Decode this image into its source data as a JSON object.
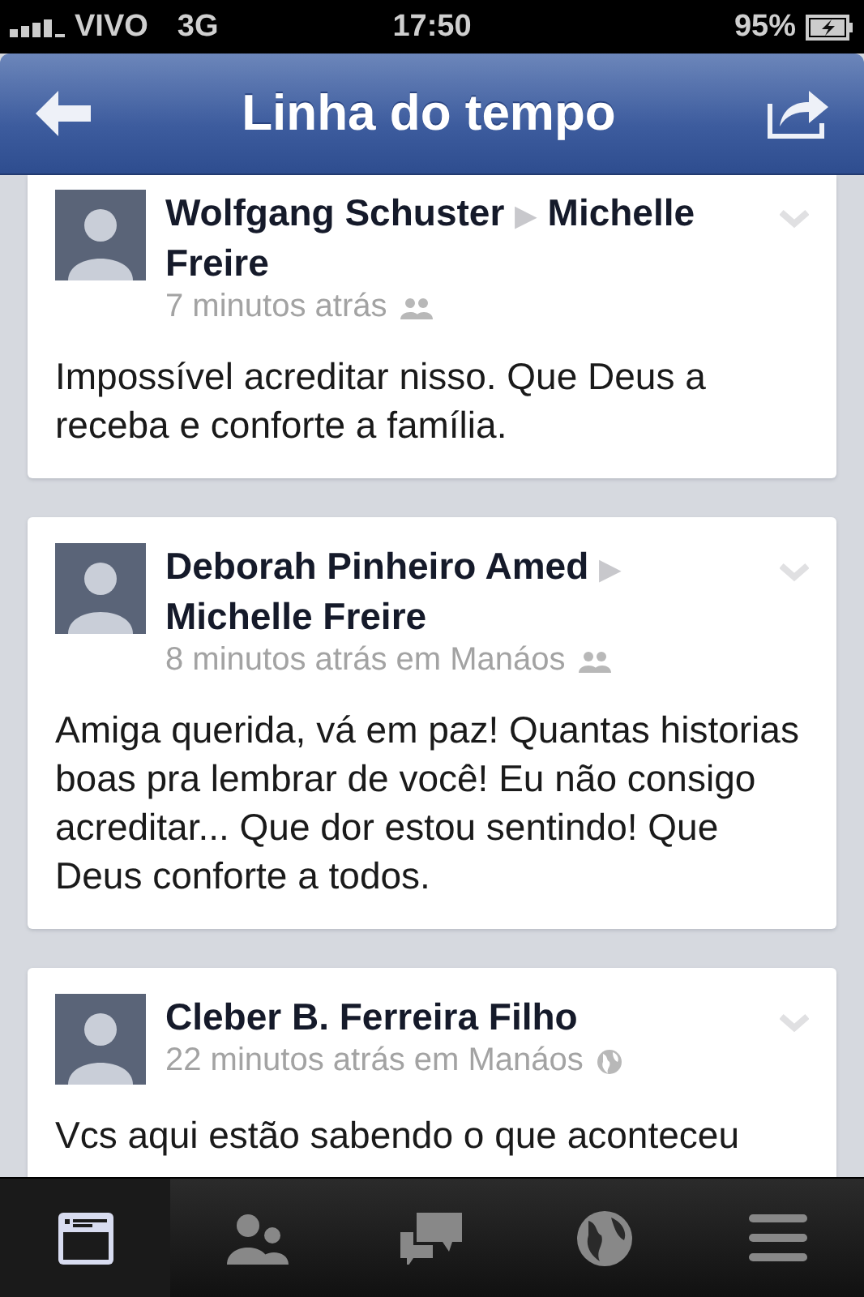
{
  "status_bar": {
    "carrier": "VIVO",
    "network": "3G",
    "time": "17:50",
    "battery": "95%"
  },
  "header": {
    "title": "Linha do tempo"
  },
  "posts": [
    {
      "author": "Wolfgang Schuster",
      "separator": "▶",
      "target": "Michelle Freire",
      "time": "7 minutos atrás",
      "kind": "friends",
      "body": "Impossível acreditar nisso. Que Deus a receba e conforte a família."
    },
    {
      "author": "Deborah Pinheiro Amed",
      "separator": "▶",
      "target": "Michelle Freire",
      "time": "8 minutos atrás em Manáos",
      "kind": "friends",
      "body": "Amiga querida, vá em paz! Quantas historias boas pra lembrar de você! Eu não consigo acreditar... Que dor estou sentindo! Que Deus conforte a todos."
    },
    {
      "author": "Cleber B. Ferreira Filho",
      "time": "22 minutos atrás em Manáos",
      "kind": "public",
      "body": "Vcs aqui estão sabendo o que aconteceu"
    }
  ],
  "tab_bar": [
    {
      "kind": "feed",
      "selected": true
    },
    {
      "kind": "friends",
      "selected": false
    },
    {
      "kind": "messages",
      "selected": false
    },
    {
      "kind": "notifications",
      "selected": false
    },
    {
      "kind": "menu",
      "selected": false
    }
  ]
}
